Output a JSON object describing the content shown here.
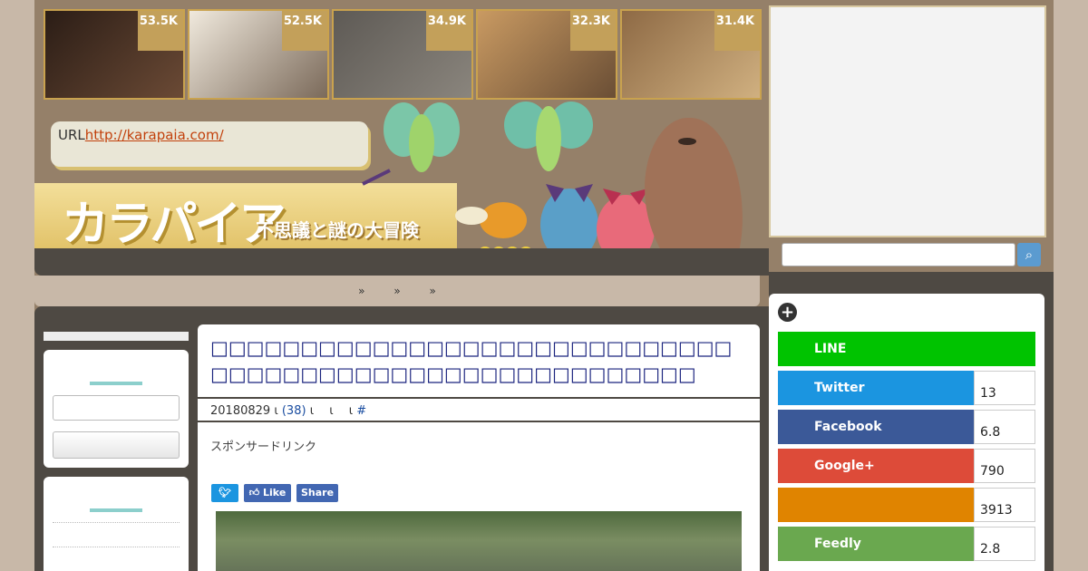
{
  "ranking": [
    {
      "count": "53.5K",
      "colors": [
        "#2b1d16",
        "#6b4a35"
      ]
    },
    {
      "count": "52.5K",
      "colors": [
        "#f0e9dd",
        "#7b6a5a"
      ]
    },
    {
      "count": "34.9K",
      "colors": [
        "#5e5a55",
        "#8a857d"
      ]
    },
    {
      "count": "32.3K",
      "colors": [
        "#c99a62",
        "#6a4e35"
      ]
    },
    {
      "count": "31.4K",
      "colors": [
        "#8e6a45",
        "#d0b080"
      ]
    }
  ],
  "url_box": {
    "label": "URL",
    "link": "http://karapaia.com/"
  },
  "site": {
    "logo": "カラパイア",
    "tagline": "不思議と謎の大冒険"
  },
  "nav": [
    "»",
    "»",
    "»"
  ],
  "article": {
    "title": "□□□□□□□□□□□□□□□□□□□□□□□□□□□□□□□□□□□□□□□□□□□□□□□□□□□□□□□□",
    "meta": {
      "date": "20180829",
      "sep": "ι",
      "comments": "(38)",
      "tail": "ι　 ι 　ι",
      "hash": "#"
    },
    "sponsor": "スポンサードリンク",
    "buttons": {
      "twitter": "",
      "like": "Like",
      "share": "Share"
    }
  },
  "share": [
    {
      "name": "LINE",
      "count": "",
      "color": "#00c300"
    },
    {
      "name": "Twitter",
      "count": "13",
      "color": "#1b95e0"
    },
    {
      "name": "Facebook",
      "count": "6.8",
      "color": "#3b5998"
    },
    {
      "name": "Google+",
      "count": "790",
      "color": "#dd4b39"
    },
    {
      "name": "",
      "count": "3913",
      "color": "#e08400"
    },
    {
      "name": "Feedly",
      "count": "2.8",
      "color": "#6cc655"
    }
  ]
}
